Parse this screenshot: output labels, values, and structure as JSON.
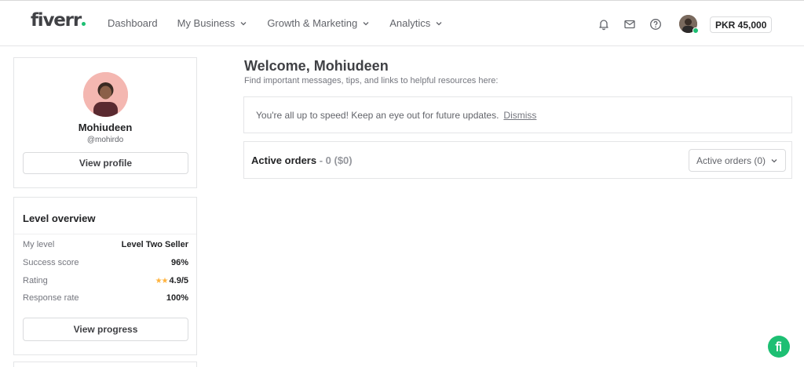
{
  "header": {
    "logo": "fiverr",
    "nav": [
      {
        "label": "Dashboard",
        "has_dropdown": false
      },
      {
        "label": "My Business",
        "has_dropdown": true
      },
      {
        "label": "Growth & Marketing",
        "has_dropdown": true
      },
      {
        "label": "Analytics",
        "has_dropdown": true
      }
    ],
    "icons": [
      "bell-icon",
      "envelope-icon",
      "help-icon"
    ],
    "balance": "PKR 45,000"
  },
  "profile": {
    "name": "Mohiudeen",
    "handle": "@mohirdo",
    "view_profile_label": "View profile"
  },
  "level_overview": {
    "title": "Level overview",
    "rows": [
      {
        "label": "My level",
        "value": "Level Two Seller"
      },
      {
        "label": "Success score",
        "value": "96%"
      },
      {
        "label": "Rating",
        "value": "4.9/5",
        "stars": 2
      },
      {
        "label": "Response rate",
        "value": "100%"
      }
    ],
    "view_progress_label": "View progress"
  },
  "main": {
    "welcome_title": "Welcome, Mohiudeen",
    "welcome_subtitle": "Find important messages, tips, and links to helpful resources here:",
    "notice_text": "You're all up to speed! Keep an eye out for future updates.",
    "dismiss_label": "Dismiss",
    "orders_title": "Active orders",
    "orders_count": " - 0 ($0)",
    "orders_select": "Active orders (0)"
  },
  "colors": {
    "brand_green": "#1dbf73",
    "star": "#ffb33e",
    "text_dark": "#404145"
  }
}
